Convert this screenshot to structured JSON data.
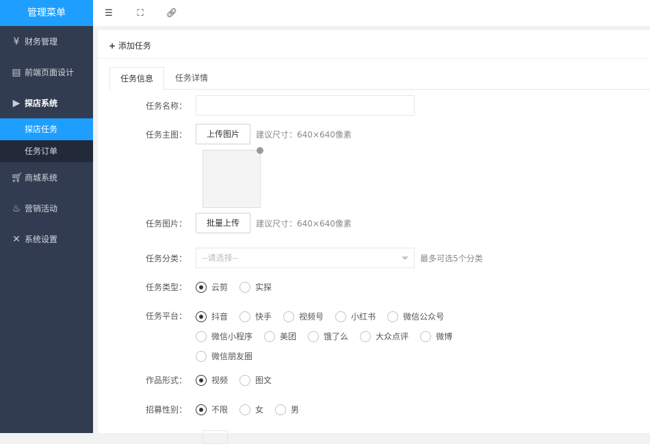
{
  "sidebar": {
    "title": "管理菜单",
    "items": [
      {
        "label": "财务管理",
        "icon": "yen-icon"
      },
      {
        "label": "前端页面设计",
        "icon": "layout-icon"
      },
      {
        "label": "探店系统",
        "icon": "video-icon"
      },
      {
        "label": "商城系统",
        "icon": "cart-icon"
      },
      {
        "label": "营销活动",
        "icon": "fire-icon"
      },
      {
        "label": "系统设置",
        "icon": "tools-icon"
      }
    ],
    "sub": [
      "探店任务",
      "任务订单"
    ]
  },
  "header": {
    "title": "添加任务",
    "tabs": [
      "任务信息",
      "任务详情"
    ]
  },
  "form": {
    "name_label": "任务名称：",
    "main_img_label": "任务主图：",
    "upload": "上传图片",
    "size_tip": "建议尺寸：640×640像素",
    "imgs_label": "任务图片：",
    "batch": "批量上传",
    "cat_label": "任务分类：",
    "cat_placeholder": "--请选择--",
    "cat_tip": "最多可选5个分类",
    "type_label": "任务类型：",
    "types": [
      "云剪",
      "实探"
    ],
    "platform_label": "任务平台：",
    "platforms": [
      "抖音",
      "快手",
      "视频号",
      "小红书",
      "微信公众号",
      "微信小程序",
      "美团",
      "饿了么",
      "大众点评",
      "微博",
      "微信朋友圈"
    ],
    "form_label": "作品形式：",
    "forms": [
      "视频",
      "图文"
    ],
    "gender_label": "招募性别：",
    "genders": [
      "不限",
      "女",
      "男"
    ]
  }
}
